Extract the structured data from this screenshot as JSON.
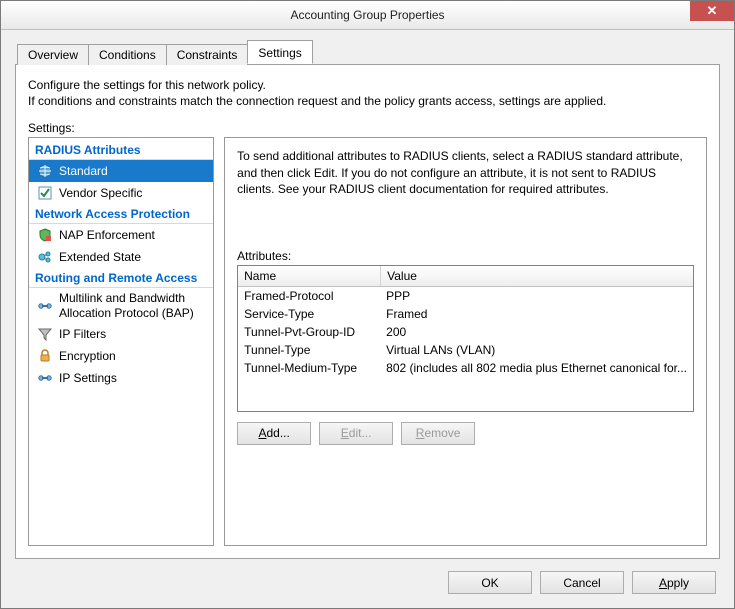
{
  "window": {
    "title": "Accounting Group Properties"
  },
  "tabs": [
    {
      "label": "Overview"
    },
    {
      "label": "Conditions"
    },
    {
      "label": "Constraints"
    },
    {
      "label": "Settings"
    }
  ],
  "intro": {
    "line1": "Configure the settings for this network policy.",
    "line2": "If conditions and constraints match the connection request and the policy grants access, settings are applied."
  },
  "settings_label": "Settings:",
  "tree": {
    "groups": [
      {
        "header": "RADIUS Attributes",
        "items": [
          {
            "icon": "globe-icon",
            "label": "Standard",
            "selected": true
          },
          {
            "icon": "checkbox-icon",
            "label": "Vendor Specific"
          }
        ]
      },
      {
        "header": "Network Access Protection",
        "items": [
          {
            "icon": "shield-icon",
            "label": "NAP Enforcement"
          },
          {
            "icon": "node-icon",
            "label": "Extended State"
          }
        ]
      },
      {
        "header": "Routing and Remote Access",
        "items": [
          {
            "icon": "link-icon",
            "label": "Multilink and Bandwidth Allocation Protocol (BAP)"
          },
          {
            "icon": "funnel-icon",
            "label": "IP Filters"
          },
          {
            "icon": "lock-icon",
            "label": "Encryption"
          },
          {
            "icon": "link-icon",
            "label": "IP Settings"
          }
        ]
      }
    ]
  },
  "right": {
    "description": "To send additional attributes to RADIUS clients, select a RADIUS standard attribute, and then click Edit. If you do not configure an attribute, it is not sent to RADIUS clients. See your RADIUS client documentation for required attributes.",
    "attributes_label": "Attributes:",
    "columns": {
      "name": "Name",
      "value": "Value"
    },
    "rows": [
      {
        "name": "Framed-Protocol",
        "value": "PPP"
      },
      {
        "name": "Service-Type",
        "value": "Framed"
      },
      {
        "name": "Tunnel-Pvt-Group-ID",
        "value": "200"
      },
      {
        "name": "Tunnel-Type",
        "value": "Virtual LANs (VLAN)"
      },
      {
        "name": "Tunnel-Medium-Type",
        "value": "802 (includes all 802 media plus Ethernet canonical for..."
      }
    ],
    "buttons": {
      "add": "Add...",
      "edit": "Edit...",
      "remove": "Remove"
    }
  },
  "dialog_buttons": {
    "ok": "OK",
    "cancel": "Cancel",
    "apply": "Apply"
  }
}
